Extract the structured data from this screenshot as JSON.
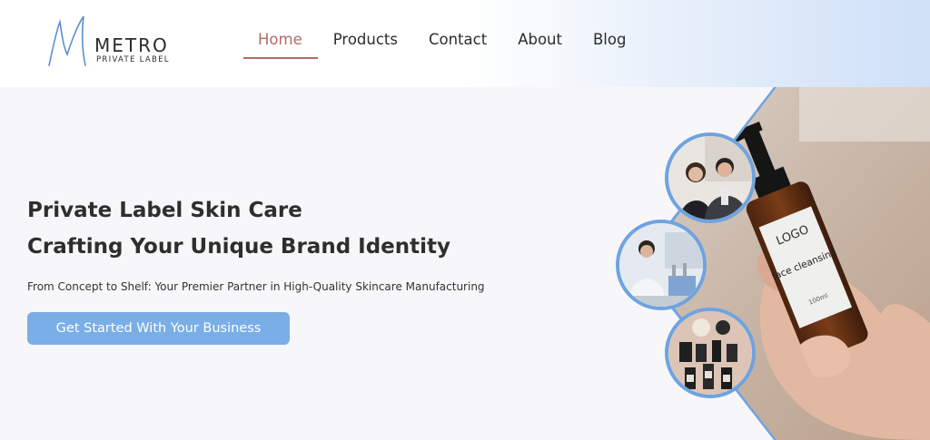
{
  "brand": {
    "name": "METRO",
    "tagline": "PRIVATE LABEL"
  },
  "nav": {
    "items": [
      {
        "label": "Home",
        "active": true
      },
      {
        "label": "Products"
      },
      {
        "label": "Contact"
      },
      {
        "label": "About"
      },
      {
        "label": "Blog"
      }
    ]
  },
  "hero": {
    "title_line1": "Private Label Skin Care",
    "title_line2": "Crafting Your Unique Brand Identity",
    "subtitle": "From Concept to Shelf: Your Premier Partner in High-Quality Skincare Manufacturing",
    "cta_label": "Get Started With Your Business"
  },
  "product_photo": {
    "bottle_label_logo": "LOGO",
    "bottle_label_text": "face cleansing",
    "bottle_label_volume": "100ml"
  },
  "colors": {
    "accent_blue": "#7aaee6",
    "active_nav": "#b06b64",
    "frame_blue": "#6fa3e0"
  }
}
